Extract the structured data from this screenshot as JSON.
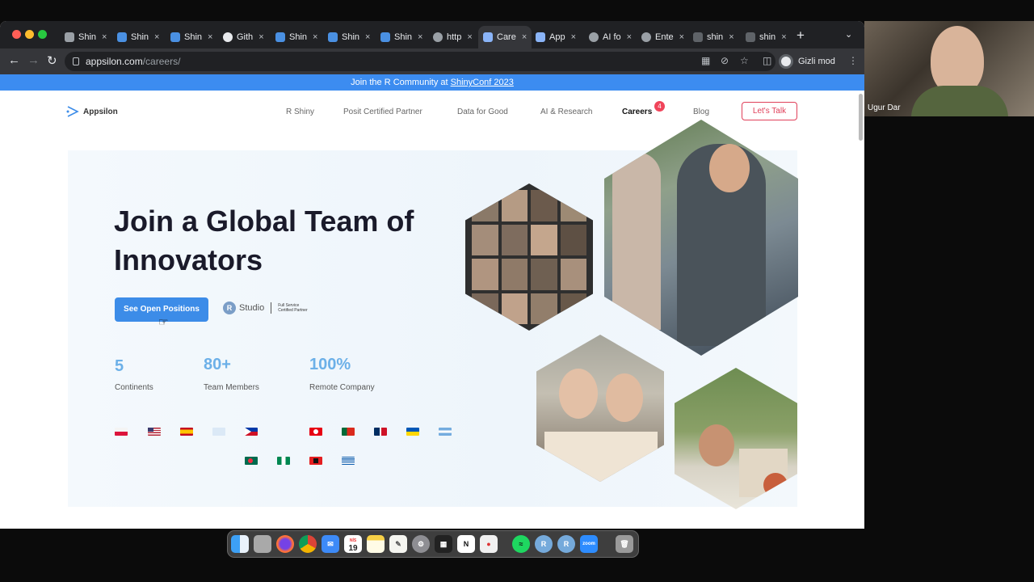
{
  "browser": {
    "tabs": [
      {
        "label": "Shin",
        "fav": "#9aa0a6"
      },
      {
        "label": "Shin",
        "fav": "#4a90e2"
      },
      {
        "label": "Shin",
        "fav": "#4a90e2"
      },
      {
        "label": "Gith",
        "fav": "#e8eaed"
      },
      {
        "label": "Shin",
        "fav": "#4a90e2"
      },
      {
        "label": "Shin",
        "fav": "#4a90e2"
      },
      {
        "label": "Shin",
        "fav": "#4a90e2"
      },
      {
        "label": "http",
        "fav": "#9aa0a6"
      },
      {
        "label": "Care",
        "fav": "#8ab4f8"
      },
      {
        "label": "App",
        "fav": "#8ab4f8"
      },
      {
        "label": "AI fo",
        "fav": "#9aa0a6"
      },
      {
        "label": "Ente",
        "fav": "#9aa0a6"
      },
      {
        "label": "shin",
        "fav": "#5f6368"
      },
      {
        "label": "shin",
        "fav": "#5f6368"
      }
    ],
    "close_glyph": "×",
    "new_tab": "+",
    "tab_menu": "⌄",
    "url_host": "appsilon.com",
    "url_path": "/careers/",
    "profile_label": "Gizli mod"
  },
  "page": {
    "banner_prefix": "Join the R Community at",
    "banner_link": "ShinyConf 2023",
    "logo": "Appsilon",
    "nav": [
      "R Shiny",
      "Posit Certified Partner",
      "Data for Good",
      "AI & Research",
      "Careers",
      "Blog"
    ],
    "careers_badge": "4",
    "cta_talk": "Let's Talk",
    "headline": "Join a Global Team of Innovators",
    "cta_positions": "See Open Positions",
    "partner": {
      "logo_letter": "R",
      "name": "Studio",
      "line1": "Full Service",
      "line2": "Certified Partner"
    },
    "stats": [
      {
        "value": "5",
        "label": "Continents"
      },
      {
        "value": "80+",
        "label": "Team Members"
      },
      {
        "value": "100%",
        "label": "Remote Company"
      }
    ]
  },
  "dock": {
    "calendar_day": "19",
    "calendar_month": "NİS"
  },
  "video": {
    "participant": "Ugur Dar"
  },
  "colors": {
    "accent": "#3c8ce8",
    "banner": "#3c8cf0",
    "talk": "#e0405a"
  }
}
